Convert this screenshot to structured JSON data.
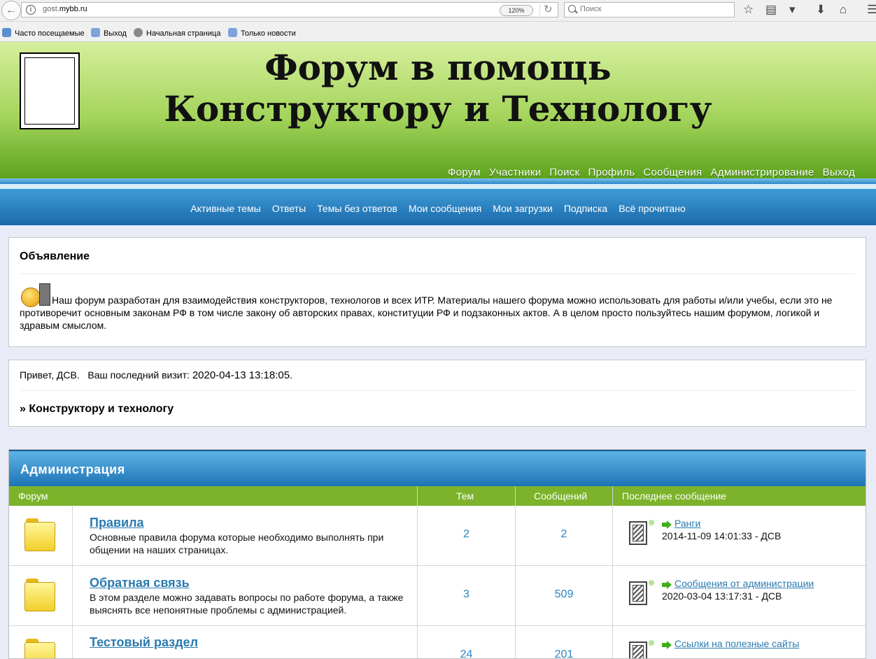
{
  "browser": {
    "url_prefix": "gost.",
    "url_domain": "mybb.ru",
    "zoom": "120%",
    "search_placeholder": "Поиск"
  },
  "bookmarks": [
    {
      "label": "Часто посещаемые"
    },
    {
      "label": "Выход"
    },
    {
      "label": "Начальная страница"
    },
    {
      "label": "Только новости"
    }
  ],
  "header": {
    "title_line1": "Форум в помощь",
    "title_line2": "Конструктору и Технологу",
    "nav": [
      "Форум",
      "Участники",
      "Поиск",
      "Профиль",
      "Сообщения",
      "Администрирование",
      "Выход"
    ]
  },
  "subnav": [
    "Активные темы",
    "Ответы",
    "Темы без ответов",
    "Мои сообщения",
    "Мои загрузки",
    "Подписка",
    "Всё прочитано"
  ],
  "announcement": {
    "title": "Объявление",
    "text": "Наш форум разработан для взаимодействия конструкторов, технологов и всех ИТР. Материалы нашего форума можно использовать для работы и/или учебы, если это не противоречит основным законам РФ в том числе закону об авторских правах, конституции РФ и подзаконных актов. А в целом просто пользуйтесь нашим форумом, логикой и здравым смыслом."
  },
  "welcome": {
    "greeting": "Привет, ",
    "user": "ДСВ",
    "greeting_end": ".",
    "last_visit_label": "Ваш последний визит: ",
    "last_visit": "2020-04-13 13:18:05",
    "last_visit_end": ".",
    "crumb": "» Конструктору и технологу"
  },
  "forum": {
    "category": "Администрация",
    "columns": {
      "forum": "Форум",
      "topics": "Тем",
      "posts": "Сообщений",
      "last": "Последнее сообщение"
    },
    "rows": [
      {
        "title": "Правила",
        "desc": "Основные правила форума которые необходимо выполнять при общении на наших страницах.",
        "topics": "2",
        "posts": "2",
        "last_link": "Ранги",
        "last_meta": "2014-11-09 14:01:33 - ДСВ"
      },
      {
        "title": "Обратная связь",
        "desc": "В этом разделе можно задавать вопросы по работе форума, а также выяснять все непонятные проблемы с администрацией.",
        "topics": "3",
        "posts": "509",
        "last_link": "Сообщения от администрации",
        "last_meta": "2020-03-04 13:17:31 - ДСВ"
      },
      {
        "title": "Тестовый раздел",
        "desc": "",
        "topics": "24",
        "posts": "201",
        "last_link": "Ссылки на полезные сайты",
        "last_meta": ""
      }
    ]
  }
}
